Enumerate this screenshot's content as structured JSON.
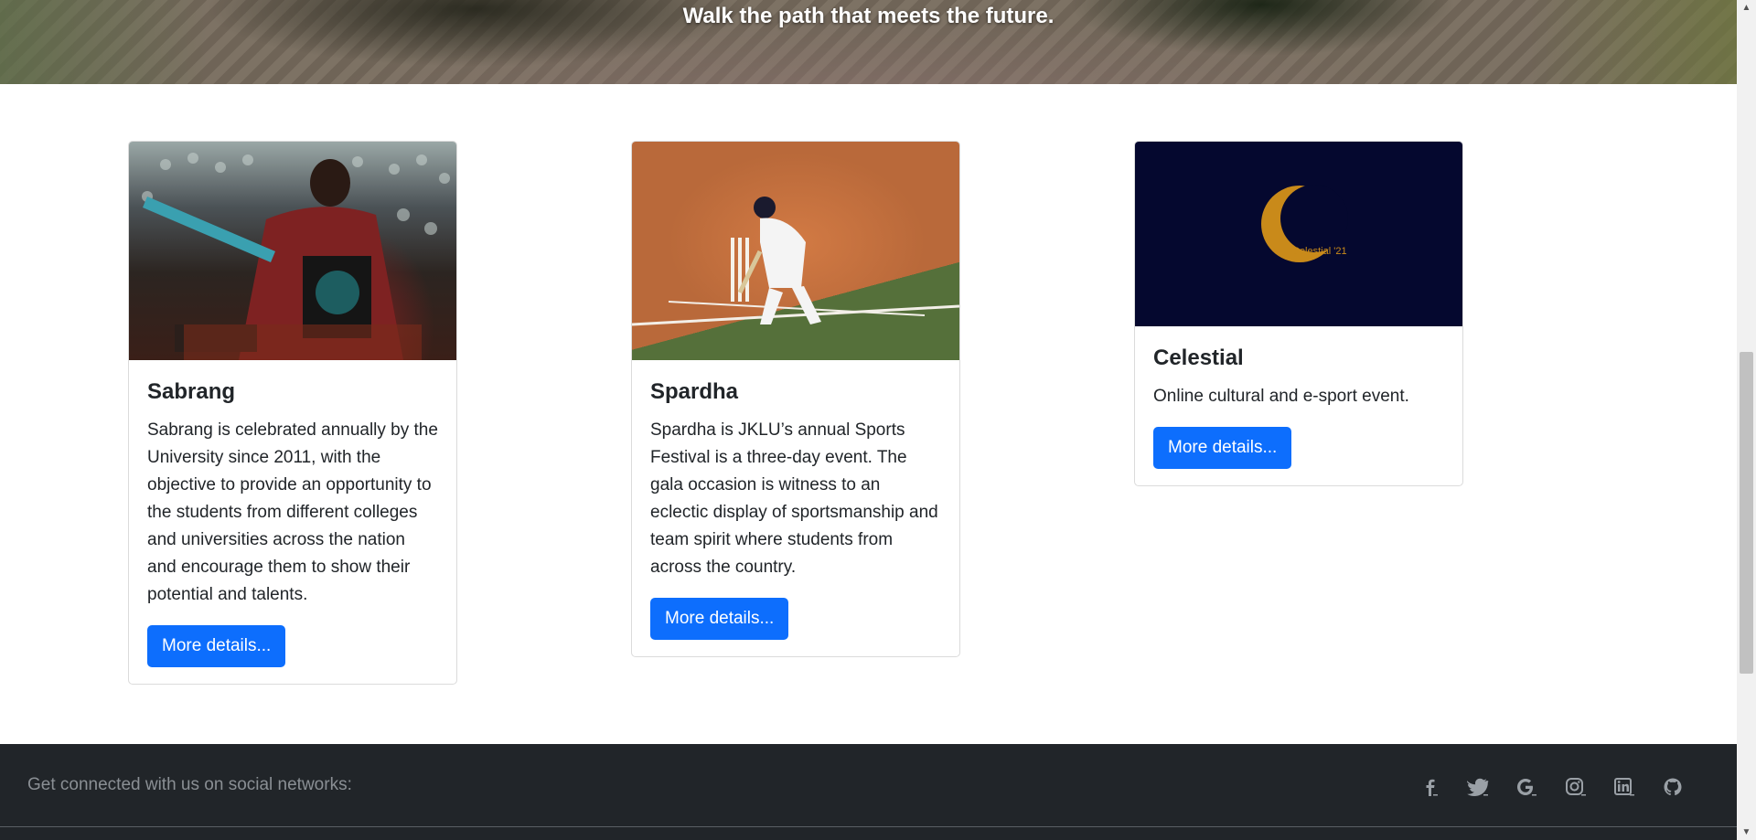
{
  "hero": {
    "caption": "Walk the path that meets the future."
  },
  "cards": [
    {
      "title": "Sabrang",
      "text": "Sabrang is celebrated annually by the University since 2011, with the objective to provide an opportunity to the students from different colleges and universities across the nation and encourage them to show their potential and talents.",
      "button": "More details..."
    },
    {
      "title": "Spardha",
      "text": "Spardha is JKLU’s annual Sports Festival is a three-day event. The gala occasion is witness to an eclectic display of sportsmanship and team spirit where students from across the country.",
      "button": "More details..."
    },
    {
      "title": "Celestial",
      "text": "Online cultural and e-sport event.",
      "button": "More details...",
      "image_text": "Celestial '21"
    }
  ],
  "footer": {
    "text": "Get connected with us on social networks:",
    "icons": [
      "facebook-icon",
      "twitter-icon",
      "google-icon",
      "instagram-icon",
      "linkedin-icon",
      "github-icon"
    ]
  },
  "colors": {
    "primary": "#0d6efd",
    "footer_bg": "#212529",
    "celestial_bg": "#05082f",
    "celestial_gold": "#c98a1a"
  }
}
